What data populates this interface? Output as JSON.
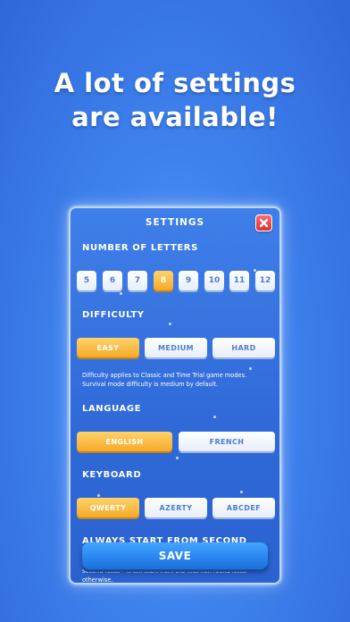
{
  "headline": {
    "line1": "A lot of settings",
    "line2": "are available!"
  },
  "settings": {
    "title": "SETTINGS",
    "close_icon": "close-icon",
    "letters": {
      "label": "NUMBER OF LETTERS",
      "options": [
        "5",
        "6",
        "7",
        "8",
        "9",
        "10",
        "11",
        "12"
      ],
      "selected": "8"
    },
    "difficulty": {
      "label": "DIFFICULTY",
      "options": [
        "EASY",
        "MEDIUM",
        "HARD"
      ],
      "selected": "EASY",
      "note": "Difficulty applies to Classic and Time Trial game modes. Survival mode difficulty is medium by default."
    },
    "language": {
      "label": "LANGUAGE",
      "options": [
        "ENGLISH",
        "FRENCH"
      ],
      "selected": "ENGLISH"
    },
    "keyboard": {
      "label": "KEYBOARD",
      "options": [
        "QWERTY",
        "AZERTY",
        "ABCDEF"
      ],
      "selected": "QWERTY"
    },
    "second_letter": {
      "label": "ALWAYS START FROM SECOND LETTER",
      "note_tail": "second letter - it will start from the first non found letter otherwise."
    },
    "save_label": "SAVE"
  },
  "colors": {
    "accent_selected": "#f5a928",
    "button_text": "#4b7dd9",
    "background": "#3673e3",
    "close": "#e23030"
  }
}
